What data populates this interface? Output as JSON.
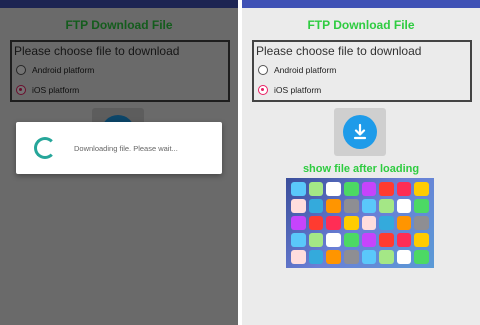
{
  "app": {
    "title": "FTP Download File",
    "choose_heading": "Please choose file to download",
    "options": [
      {
        "label": "Android platform",
        "selected": false
      },
      {
        "label": "iOS platform",
        "selected": true
      }
    ],
    "download_icon": "download-icon",
    "show_label": "show file after loading"
  },
  "dialog": {
    "message": "Downloading file. Please wait..."
  },
  "colors": {
    "title_green": "#2ecc40",
    "accent_pink": "#e91e63",
    "download_blue": "#1e9be9",
    "spinner_teal": "#26a69a",
    "statusbar": "#3f51b5"
  }
}
